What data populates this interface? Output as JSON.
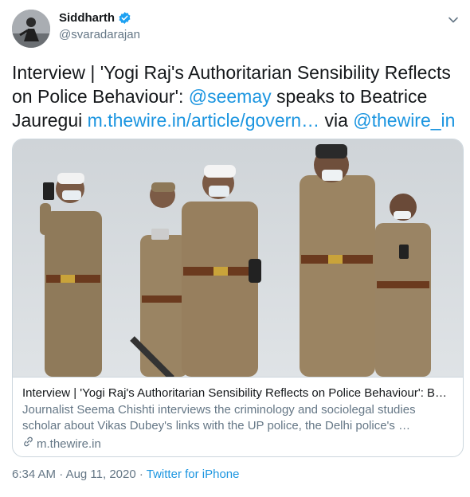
{
  "author": {
    "name": "Siddharth",
    "handle": "@svaradarajan"
  },
  "tweet": {
    "text_part1": "Interview | 'Yogi Raj's Authoritarian Sensibility Reflects on Police Behaviour': ",
    "mention1": "@seemay",
    "text_part2": " speaks to Beatrice Jauregui ",
    "link": "m.thewire.in/article/govern…",
    "text_part3": " via ",
    "mention2": "@thewire_in"
  },
  "card": {
    "title": "Interview | 'Yogi Raj's Authoritarian Sensibility Reflects on Police Behaviour': B…",
    "description": "Journalist Seema Chishti interviews the criminology and sociolegal studies scholar about Vikas Dubey's links with the UP police, the Delhi police's …",
    "domain": "m.thewire.in"
  },
  "meta": {
    "time": "6:34 AM",
    "separator1": " · ",
    "date": "Aug 11, 2020",
    "separator2": " · ",
    "source": "Twitter for iPhone"
  },
  "colors": {
    "link": "#1b95e0",
    "verified": "#1da1f2",
    "secondary_text": "#657786"
  },
  "icons": [
    "verified-badge-icon",
    "chevron-down-icon",
    "link-icon"
  ]
}
